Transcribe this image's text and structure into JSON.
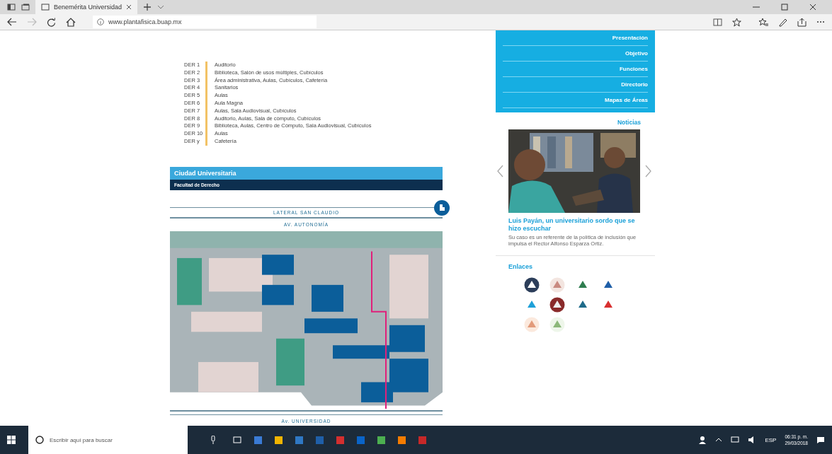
{
  "browser": {
    "tab_title": "Benemérita Universidad",
    "address": "www.plantafisica.buap.mx"
  },
  "buildings": [
    {
      "code": "DER 1",
      "use": "Auditorio"
    },
    {
      "code": "DER 2",
      "use": "Biblioteca, Salón de usos múltiples, Cubículos"
    },
    {
      "code": "DER 3",
      "use": "Área administrativa, Aulas, Cubículos, Cafetería"
    },
    {
      "code": "DER 4",
      "use": "Sanitarios"
    },
    {
      "code": "DER 5",
      "use": "Aulas"
    },
    {
      "code": "DER 6",
      "use": "Aula Magna"
    },
    {
      "code": "DER 7",
      "use": "Aulas, Sala Audiovisual, Cubículos"
    },
    {
      "code": "DER 8",
      "use": "Auditorio, Aulas, Sala de cómputo, Cubículos"
    },
    {
      "code": "DER 9",
      "use": "Biblioteca, Aulas, Centro de Cómputo, Sala Audiovisual, Cubículos"
    },
    {
      "code": "DER 10",
      "use": "Aulas"
    },
    {
      "code": "DER y",
      "use": "Cafetería"
    }
  ],
  "campus": "Ciudad Universitaria",
  "faculty": "Facultad de Derecho",
  "streets": {
    "top_lateral": "LATERAL SAN CLAUDIO",
    "top": "AV. AUTONOMÍA",
    "bottom": "Av. UNIVERSIDAD"
  },
  "menu": [
    "Presentación",
    "Objetivo",
    "Funciones",
    "Directorio",
    "Mapas de Áreas"
  ],
  "news": {
    "heading": "Noticias",
    "title": "Luis Payán, un universitario sordo que se hizo escuchar",
    "summary": "Su caso es un referente de la política de inclusión que impulsa el Rector Alfonso Esparza Ortiz."
  },
  "links_heading": "Enlaces",
  "taskbar": {
    "search_placeholder": "Escribir aquí para buscar",
    "language": "ESP",
    "time": "06:31 p. m.",
    "date": "29/03/2018"
  }
}
